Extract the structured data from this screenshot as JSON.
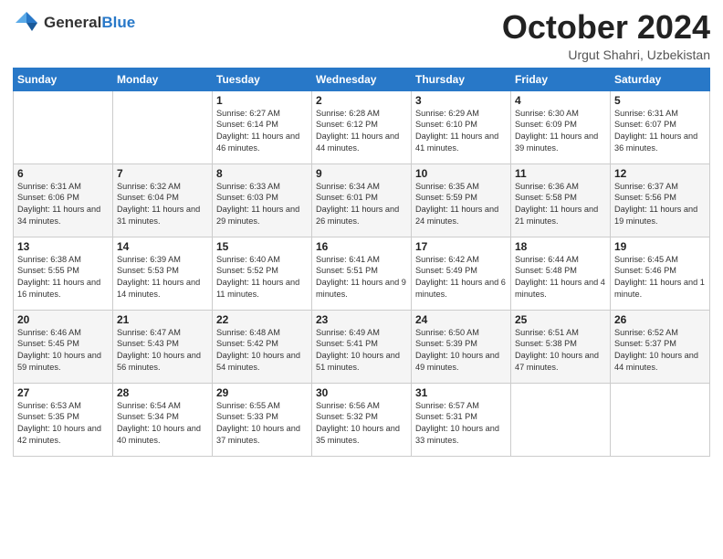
{
  "header": {
    "logo_general": "General",
    "logo_blue": "Blue",
    "title": "October 2024",
    "location": "Urgut Shahri, Uzbekistan"
  },
  "days_of_week": [
    "Sunday",
    "Monday",
    "Tuesday",
    "Wednesday",
    "Thursday",
    "Friday",
    "Saturday"
  ],
  "weeks": [
    [
      {
        "day": "",
        "sunrise": "",
        "sunset": "",
        "daylight": ""
      },
      {
        "day": "",
        "sunrise": "",
        "sunset": "",
        "daylight": ""
      },
      {
        "day": "1",
        "sunrise": "Sunrise: 6:27 AM",
        "sunset": "Sunset: 6:14 PM",
        "daylight": "Daylight: 11 hours and 46 minutes."
      },
      {
        "day": "2",
        "sunrise": "Sunrise: 6:28 AM",
        "sunset": "Sunset: 6:12 PM",
        "daylight": "Daylight: 11 hours and 44 minutes."
      },
      {
        "day": "3",
        "sunrise": "Sunrise: 6:29 AM",
        "sunset": "Sunset: 6:10 PM",
        "daylight": "Daylight: 11 hours and 41 minutes."
      },
      {
        "day": "4",
        "sunrise": "Sunrise: 6:30 AM",
        "sunset": "Sunset: 6:09 PM",
        "daylight": "Daylight: 11 hours and 39 minutes."
      },
      {
        "day": "5",
        "sunrise": "Sunrise: 6:31 AM",
        "sunset": "Sunset: 6:07 PM",
        "daylight": "Daylight: 11 hours and 36 minutes."
      }
    ],
    [
      {
        "day": "6",
        "sunrise": "Sunrise: 6:31 AM",
        "sunset": "Sunset: 6:06 PM",
        "daylight": "Daylight: 11 hours and 34 minutes."
      },
      {
        "day": "7",
        "sunrise": "Sunrise: 6:32 AM",
        "sunset": "Sunset: 6:04 PM",
        "daylight": "Daylight: 11 hours and 31 minutes."
      },
      {
        "day": "8",
        "sunrise": "Sunrise: 6:33 AM",
        "sunset": "Sunset: 6:03 PM",
        "daylight": "Daylight: 11 hours and 29 minutes."
      },
      {
        "day": "9",
        "sunrise": "Sunrise: 6:34 AM",
        "sunset": "Sunset: 6:01 PM",
        "daylight": "Daylight: 11 hours and 26 minutes."
      },
      {
        "day": "10",
        "sunrise": "Sunrise: 6:35 AM",
        "sunset": "Sunset: 5:59 PM",
        "daylight": "Daylight: 11 hours and 24 minutes."
      },
      {
        "day": "11",
        "sunrise": "Sunrise: 6:36 AM",
        "sunset": "Sunset: 5:58 PM",
        "daylight": "Daylight: 11 hours and 21 minutes."
      },
      {
        "day": "12",
        "sunrise": "Sunrise: 6:37 AM",
        "sunset": "Sunset: 5:56 PM",
        "daylight": "Daylight: 11 hours and 19 minutes."
      }
    ],
    [
      {
        "day": "13",
        "sunrise": "Sunrise: 6:38 AM",
        "sunset": "Sunset: 5:55 PM",
        "daylight": "Daylight: 11 hours and 16 minutes."
      },
      {
        "day": "14",
        "sunrise": "Sunrise: 6:39 AM",
        "sunset": "Sunset: 5:53 PM",
        "daylight": "Daylight: 11 hours and 14 minutes."
      },
      {
        "day": "15",
        "sunrise": "Sunrise: 6:40 AM",
        "sunset": "Sunset: 5:52 PM",
        "daylight": "Daylight: 11 hours and 11 minutes."
      },
      {
        "day": "16",
        "sunrise": "Sunrise: 6:41 AM",
        "sunset": "Sunset: 5:51 PM",
        "daylight": "Daylight: 11 hours and 9 minutes."
      },
      {
        "day": "17",
        "sunrise": "Sunrise: 6:42 AM",
        "sunset": "Sunset: 5:49 PM",
        "daylight": "Daylight: 11 hours and 6 minutes."
      },
      {
        "day": "18",
        "sunrise": "Sunrise: 6:44 AM",
        "sunset": "Sunset: 5:48 PM",
        "daylight": "Daylight: 11 hours and 4 minutes."
      },
      {
        "day": "19",
        "sunrise": "Sunrise: 6:45 AM",
        "sunset": "Sunset: 5:46 PM",
        "daylight": "Daylight: 11 hours and 1 minute."
      }
    ],
    [
      {
        "day": "20",
        "sunrise": "Sunrise: 6:46 AM",
        "sunset": "Sunset: 5:45 PM",
        "daylight": "Daylight: 10 hours and 59 minutes."
      },
      {
        "day": "21",
        "sunrise": "Sunrise: 6:47 AM",
        "sunset": "Sunset: 5:43 PM",
        "daylight": "Daylight: 10 hours and 56 minutes."
      },
      {
        "day": "22",
        "sunrise": "Sunrise: 6:48 AM",
        "sunset": "Sunset: 5:42 PM",
        "daylight": "Daylight: 10 hours and 54 minutes."
      },
      {
        "day": "23",
        "sunrise": "Sunrise: 6:49 AM",
        "sunset": "Sunset: 5:41 PM",
        "daylight": "Daylight: 10 hours and 51 minutes."
      },
      {
        "day": "24",
        "sunrise": "Sunrise: 6:50 AM",
        "sunset": "Sunset: 5:39 PM",
        "daylight": "Daylight: 10 hours and 49 minutes."
      },
      {
        "day": "25",
        "sunrise": "Sunrise: 6:51 AM",
        "sunset": "Sunset: 5:38 PM",
        "daylight": "Daylight: 10 hours and 47 minutes."
      },
      {
        "day": "26",
        "sunrise": "Sunrise: 6:52 AM",
        "sunset": "Sunset: 5:37 PM",
        "daylight": "Daylight: 10 hours and 44 minutes."
      }
    ],
    [
      {
        "day": "27",
        "sunrise": "Sunrise: 6:53 AM",
        "sunset": "Sunset: 5:35 PM",
        "daylight": "Daylight: 10 hours and 42 minutes."
      },
      {
        "day": "28",
        "sunrise": "Sunrise: 6:54 AM",
        "sunset": "Sunset: 5:34 PM",
        "daylight": "Daylight: 10 hours and 40 minutes."
      },
      {
        "day": "29",
        "sunrise": "Sunrise: 6:55 AM",
        "sunset": "Sunset: 5:33 PM",
        "daylight": "Daylight: 10 hours and 37 minutes."
      },
      {
        "day": "30",
        "sunrise": "Sunrise: 6:56 AM",
        "sunset": "Sunset: 5:32 PM",
        "daylight": "Daylight: 10 hours and 35 minutes."
      },
      {
        "day": "31",
        "sunrise": "Sunrise: 6:57 AM",
        "sunset": "Sunset: 5:31 PM",
        "daylight": "Daylight: 10 hours and 33 minutes."
      },
      {
        "day": "",
        "sunrise": "",
        "sunset": "",
        "daylight": ""
      },
      {
        "day": "",
        "sunrise": "",
        "sunset": "",
        "daylight": ""
      }
    ]
  ]
}
